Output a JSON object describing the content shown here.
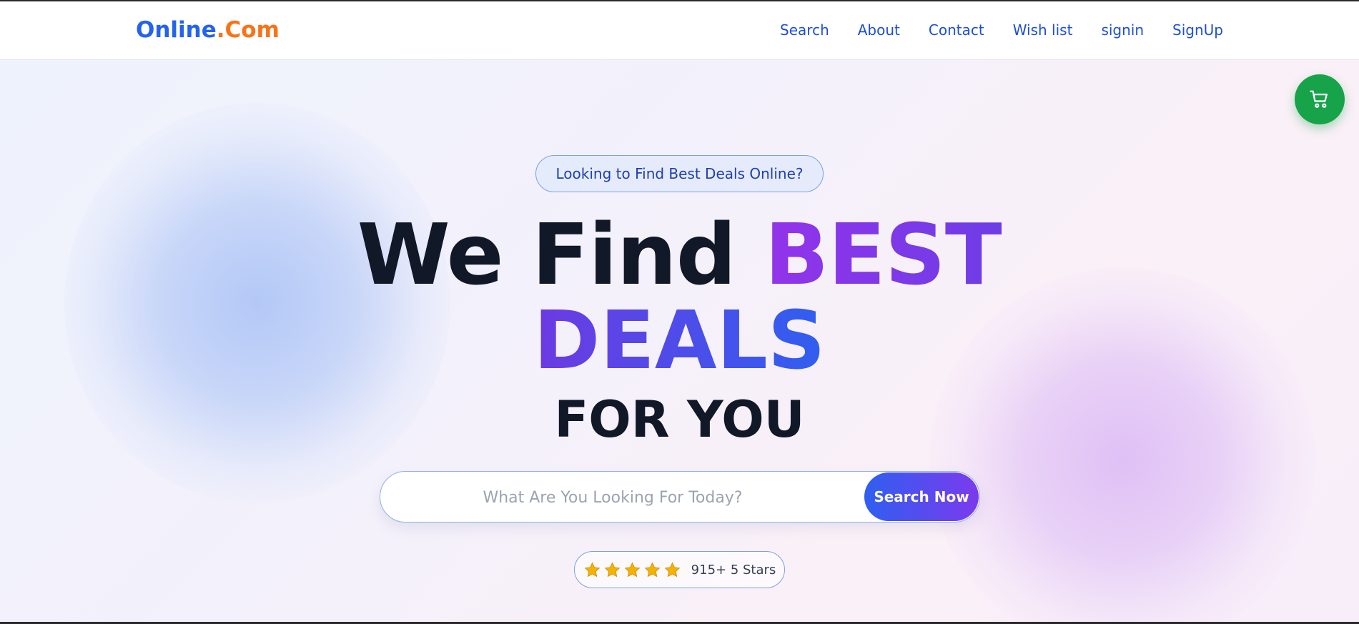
{
  "brand": {
    "part1": "Online",
    "part2": ".Com"
  },
  "nav": {
    "links": [
      {
        "label": "Search"
      },
      {
        "label": "About"
      },
      {
        "label": "Contact"
      },
      {
        "label": "Wish list"
      },
      {
        "label": "signin"
      },
      {
        "label": "SignUp"
      }
    ]
  },
  "hero": {
    "pill": "Looking to Find Best Deals Online?",
    "line1_dark": "We Find ",
    "line1_accent": "BEST",
    "line2": "DEALS",
    "line3": "FOR YOU"
  },
  "search": {
    "placeholder": "What Are You Looking For Today?",
    "button_label": "Search Now"
  },
  "rating": {
    "stars": 5,
    "text": "915+ 5 Stars"
  },
  "icons": {
    "cart": "shopping-cart-icon",
    "star": "star-icon"
  },
  "colors": {
    "brand_blue": "#2563eb",
    "brand_orange": "#f97316",
    "nav_link": "#1d4ed8",
    "cart_green": "#16a34a",
    "accent_purple": "#9333ea",
    "accent_blue": "#2f5ff0",
    "star": "#f5b301"
  }
}
